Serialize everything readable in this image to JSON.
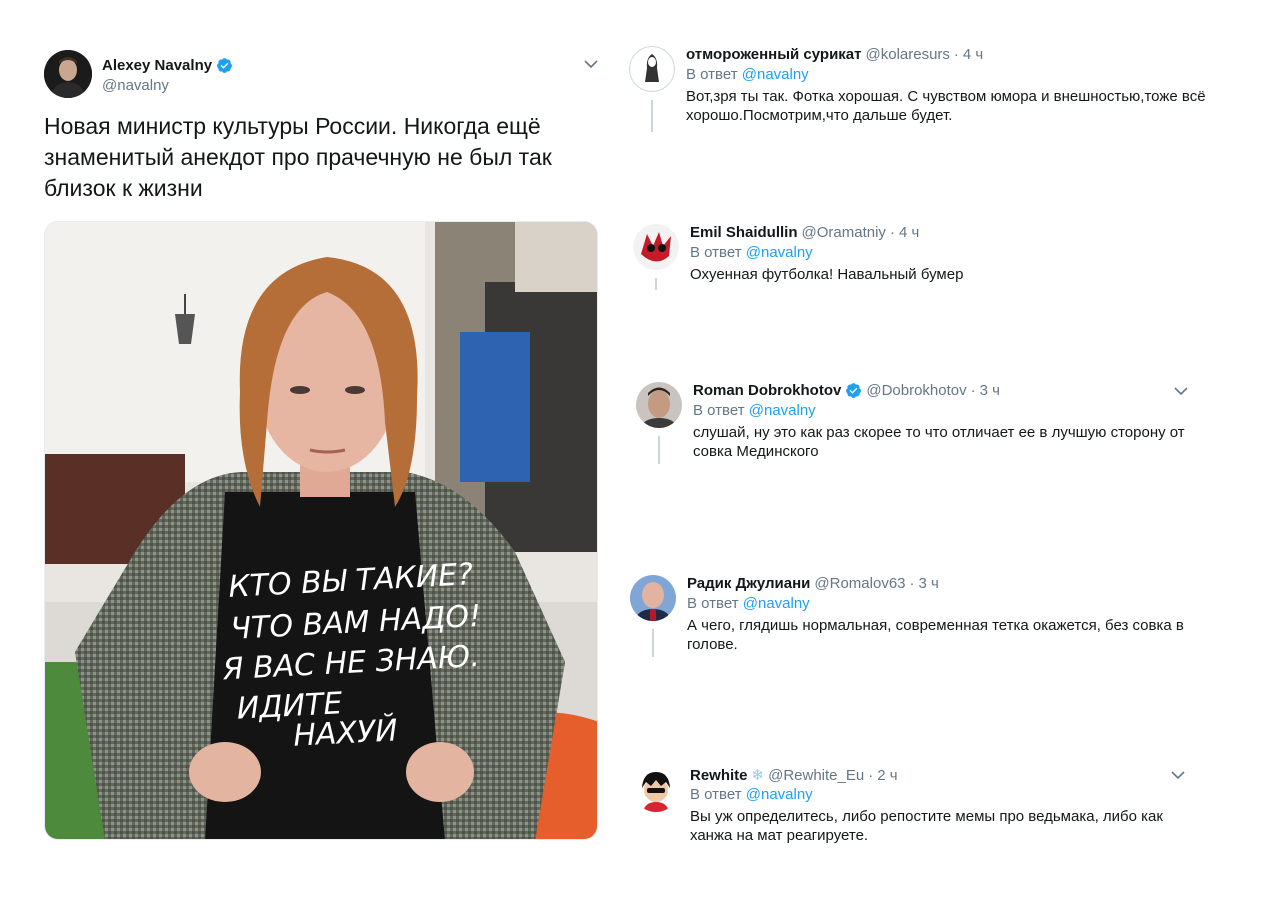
{
  "main_tweet": {
    "name": "Alexey Navalny",
    "handle": "@navalny",
    "text": "Новая министр культуры России. Никогда ещё знаменитый анекдот про прачечную не был так близок к жизни",
    "verified_color": "#1da1f2"
  },
  "shirt_text": [
    "КТО ВЫ ТАКИЕ?",
    "ЧТО ВАМ НАДО!",
    "Я ВАС НЕ ЗНАЮ.",
    "ИДИТЕ",
    "НАХУЙ"
  ],
  "replies": [
    {
      "name": "отмороженный сурикат",
      "handle": "@kolaresurs",
      "dot": "·",
      "time": "4 ч",
      "reply_prefix": "В ответ",
      "reply_to": "@navalny",
      "text": "Вот,зря ты так. Фотка хорошая. С чувством юмора и внешностью,тоже всё хорошо.Посмотрим,что дальше будет."
    },
    {
      "name": "Emil Shaidullin",
      "handle": "@Oramatniy",
      "dot": "·",
      "time": "4 ч",
      "reply_prefix": "В ответ",
      "reply_to": "@navalny",
      "text": "Охуенная футболка! Навальный бумер"
    },
    {
      "name": "Roman Dobrokhotov",
      "handle": "@Dobrokhotov",
      "dot": "·",
      "time": "3 ч",
      "reply_prefix": "В ответ",
      "reply_to": "@navalny",
      "text": "слушай, ну это как раз скорее то что отличает ее в лучшую сторону от совка Мединского"
    },
    {
      "name": "Радик Джулиани",
      "handle": "@Romalov63",
      "dot": "·",
      "time": "3 ч",
      "reply_prefix": "В ответ",
      "reply_to": "@navalny",
      "text": "А чего, глядишь нормальная, современная тетка окажется, без совка в голове."
    },
    {
      "name": "Rewhite",
      "name_emoji": "❄",
      "handle": "@Rewhite_Eu",
      "dot": "·",
      "time": "2 ч",
      "reply_prefix": "В ответ",
      "reply_to": "@navalny",
      "text": "Вы уж определитесь, либо репостите мемы про ведьмака, либо как ханжа на мат реагируете."
    }
  ],
  "icons": {
    "verified": "verified-badge-icon",
    "chevron": "chevron-down-icon"
  }
}
